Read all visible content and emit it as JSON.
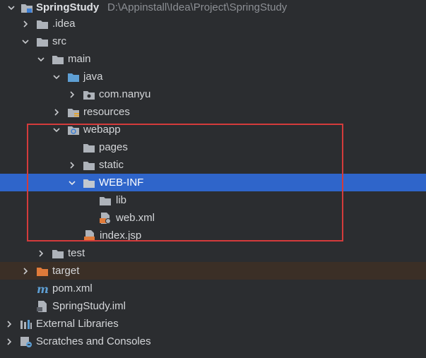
{
  "project": {
    "name": "SpringStudy",
    "path": "D:\\Appinstall\\Idea\\Project\\SpringStudy"
  },
  "items": {
    "idea": ".idea",
    "src": "src",
    "main": "main",
    "java": "java",
    "com_nanyu": "com.nanyu",
    "resources": "resources",
    "webapp": "webapp",
    "pages": "pages",
    "static": "static",
    "web_inf": "WEB-INF",
    "lib": "lib",
    "web_xml": "web.xml",
    "index_jsp": "index.jsp",
    "test": "test",
    "target": "target",
    "pom_xml": "pom.xml",
    "iml": "SpringStudy.iml",
    "external_libraries": "External Libraries",
    "scratches": "Scratches and Consoles"
  },
  "colors": {
    "background": "#2b2d30",
    "selected_row": "#2f65ca",
    "target_row": "#3b2f26",
    "annotation_box": "#d43b3b",
    "folder": "#aeb3ba",
    "source_folder": "#5e9fd4",
    "target_folder": "#e07b3a"
  }
}
